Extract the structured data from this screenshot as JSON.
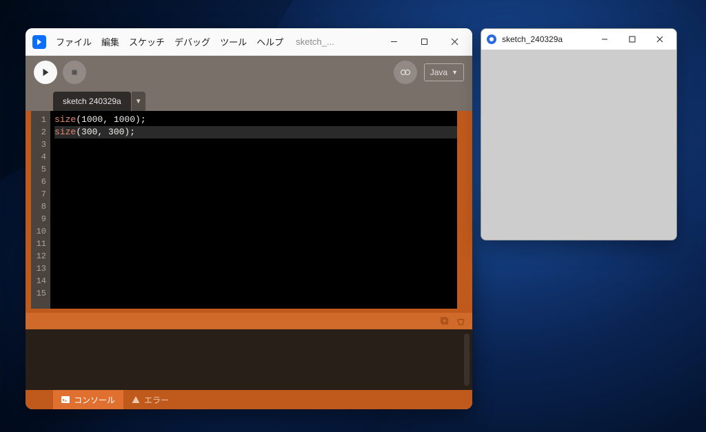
{
  "ide": {
    "menu": [
      "ファイル",
      "編集",
      "スケッチ",
      "デバッグ",
      "ツール",
      "ヘルプ"
    ],
    "sketch_name_short": "sketch_...",
    "mode_label": "Java",
    "tab_label": "sketch 240329a",
    "code_lines": [
      {
        "fn": "size",
        "args": "(1000, 1000);"
      },
      {
        "fn": "size",
        "args": "(300, 300);"
      }
    ],
    "gutter_count": 15,
    "footer": {
      "console": "コンソール",
      "errors": "エラー"
    }
  },
  "output_window": {
    "title": "sketch_240329a"
  }
}
